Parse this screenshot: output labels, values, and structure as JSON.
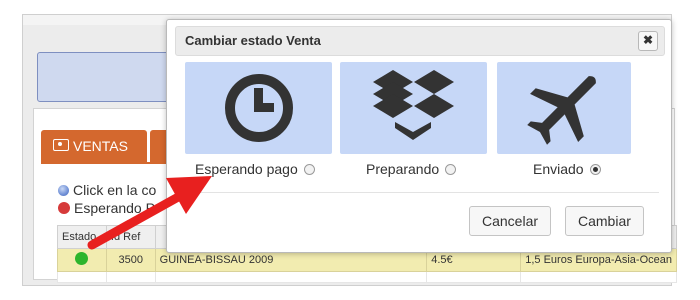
{
  "background": {
    "tab_ventas_label": "VENTAS",
    "hint_1": "Click en la co",
    "hint_2": "Esperando P",
    "table": {
      "headers": [
        "Estado",
        "Id Ref",
        "",
        "",
        ""
      ],
      "row": {
        "status_color": "#2db52d",
        "id_ref": "3500",
        "name": "GUINEA-BISSAU 2009",
        "price": "4.5€",
        "description": "1,5 Euros Europa-Asia-Ocean"
      }
    }
  },
  "modal": {
    "title": "Cambiar estado Venta",
    "close_label": "✖",
    "options": [
      {
        "icon": "clock-icon",
        "label": "Esperando pago",
        "checked": false
      },
      {
        "icon": "dropbox-box-icon",
        "label": "Preparando",
        "checked": false
      },
      {
        "icon": "airplane-icon",
        "label": "Enviado",
        "checked": true
      }
    ],
    "cancel_label": "Cancelar",
    "submit_label": "Cambiar"
  },
  "colors": {
    "option_bg": "#c6d7f7",
    "tab_accent": "#d4682e",
    "arrow": "#e8201f"
  }
}
